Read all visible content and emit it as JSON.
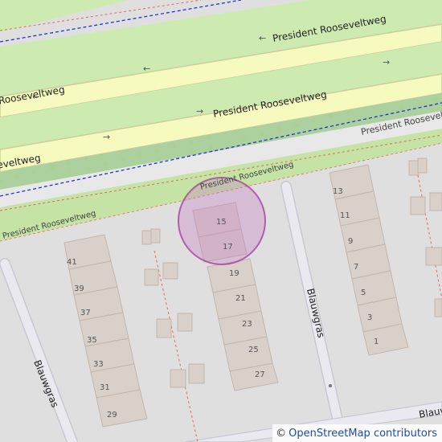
{
  "map": {
    "roads": {
      "main_road": "President Rooseveltweg",
      "side_street": "Blauwgras"
    },
    "house_numbers": {
      "block_left": [
        "41",
        "39",
        "37",
        "35",
        "33",
        "31",
        "29"
      ],
      "block_middle": [
        "15",
        "17",
        "19",
        "21",
        "23",
        "25",
        "27"
      ],
      "block_right": [
        "13",
        "11",
        "9",
        "7",
        "5",
        "3",
        "1"
      ]
    },
    "highlighted_area": {
      "numbers": [
        "15",
        "17"
      ]
    },
    "colors": {
      "background": "#e0dfdf",
      "grass": "#cdebb0",
      "road_fill": "#f7fabf",
      "road_casing": "#bfc6a0",
      "building": "#d9d0c9",
      "building_outline": "#c4b6ab",
      "footway_red": "#fa8072",
      "cycleway_blue": "#0000ff",
      "highlight": "#c060c0"
    }
  },
  "attribution": {
    "symbol": "©",
    "text": "OpenStreetMap contributors"
  }
}
